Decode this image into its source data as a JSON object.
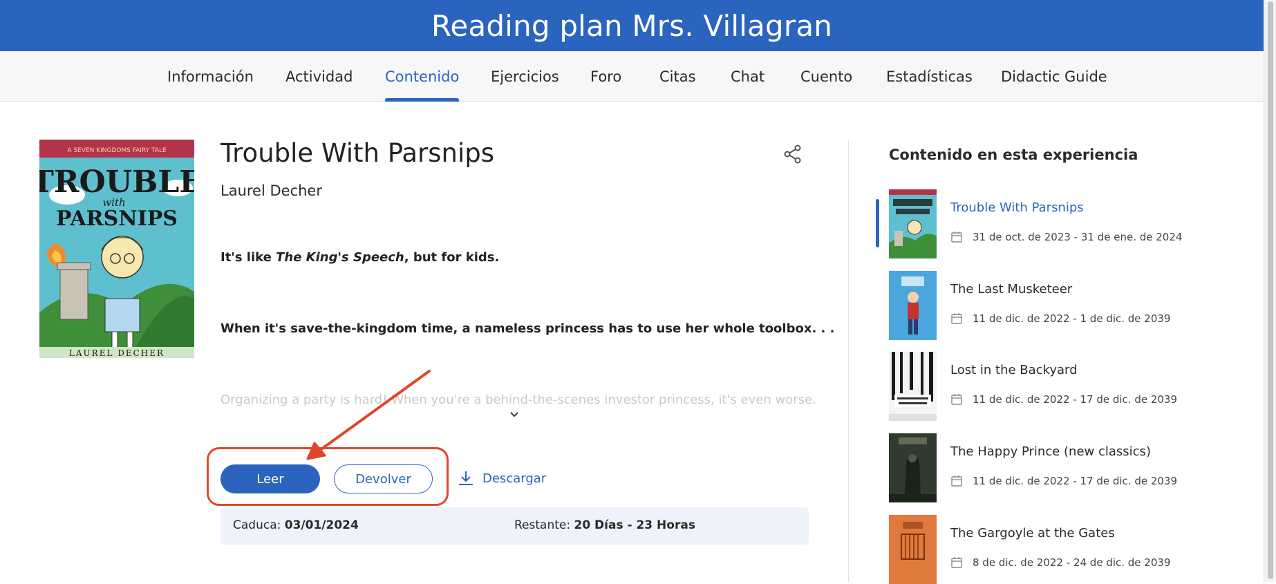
{
  "header": {
    "title": "Reading plan Mrs. Villagran"
  },
  "tabs": [
    {
      "label": "Información"
    },
    {
      "label": "Actividad"
    },
    {
      "label": "Contenido",
      "active": true
    },
    {
      "label": "Ejercicios"
    },
    {
      "label": "Foro"
    },
    {
      "label": "Citas"
    },
    {
      "label": "Chat"
    },
    {
      "label": "Cuento"
    },
    {
      "label": "Estadísticas"
    },
    {
      "label": "Didactic Guide"
    }
  ],
  "book": {
    "cover": {
      "top_banner": "A SEVEN KINGDOMS FAIRY TALE",
      "title_line1": "TROUBLE",
      "title_with": "with",
      "title_line2": "PARSNIPS",
      "author": "LAUREL DECHER"
    },
    "title": "Trouble With Parsnips",
    "author": "Laurel Decher",
    "description": {
      "line1_prefix": "It's like ",
      "line1_italic": "The King's Speech",
      "line1_suffix": ", but for kids.",
      "line2": "When it's save-the-kingdom time, a nameless princess has to use her whole toolbox. . .",
      "line3": "Organizing a party is hard! When you're a behind-the-scenes investor princess, it's even worse."
    },
    "actions": {
      "read": "Leer",
      "return": "Devolver",
      "download": "Descargar"
    },
    "expiry": {
      "expires_label": "Caduca:",
      "expires_value": "03/01/2024",
      "remaining_label": "Restante:",
      "remaining_value": "20 Días - 23 Horas"
    }
  },
  "sidebar": {
    "title": "Contenido en esta experiencia",
    "items": [
      {
        "title": "Trouble With Parsnips",
        "dates": "31 de oct. de 2023 - 31 de ene. de 2024",
        "active": true,
        "cover_color": "#5bb7c6"
      },
      {
        "title": "The Last Musketeer",
        "dates": "11 de dic. de 2022 - 1 de dic. de 2039",
        "cover_color": "#4aa6dc"
      },
      {
        "title": "Lost in the Backyard",
        "dates": "11 de dic. de 2022 - 17 de dic. de 2039",
        "cover_color": "#f2f2f2"
      },
      {
        "title": "The Happy Prince (new classics)",
        "dates": "11 de dic. de 2022 - 17 de dic. de 2039",
        "cover_color": "#2f3b2f"
      },
      {
        "title": "The Gargoyle at the Gates",
        "dates": "8 de dic. de 2022 - 24 de dic. de 2039",
        "cover_color": "#e07a3c"
      }
    ]
  },
  "colors": {
    "brand": "#2a64be",
    "highlight": "#e0462b",
    "info_bg": "#edf2fb"
  }
}
